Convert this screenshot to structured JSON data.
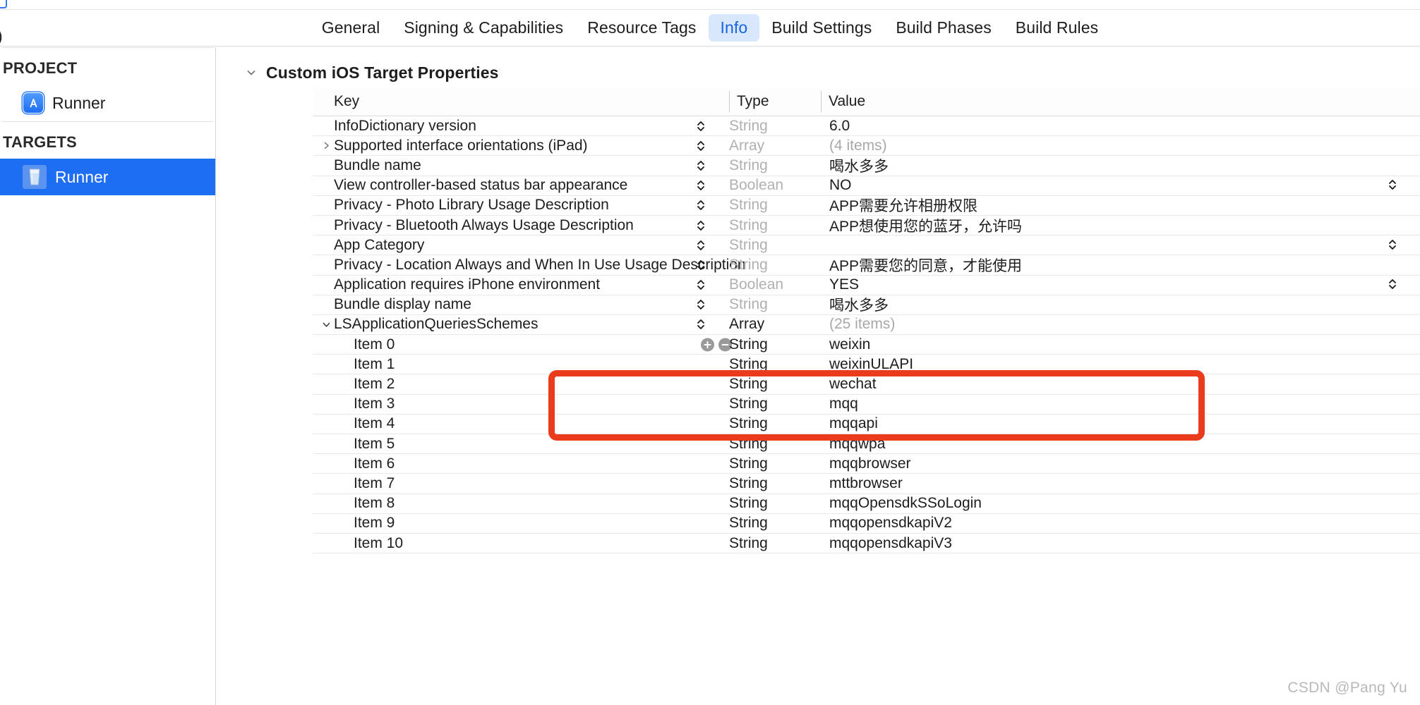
{
  "window": {
    "tabs": [
      {
        "label": "General",
        "selected": false
      },
      {
        "label": "Signing & Capabilities",
        "selected": false
      },
      {
        "label": "Resource Tags",
        "selected": false
      },
      {
        "label": "Info",
        "selected": true
      },
      {
        "label": "Build Settings",
        "selected": false
      },
      {
        "label": "Build Phases",
        "selected": false
      },
      {
        "label": "Build Rules",
        "selected": false
      }
    ],
    "accent_selected_bg": "#d9e7fd",
    "accent_selected_fg": "#1664e0",
    "annotation_color": "#ea3c1c"
  },
  "sidebar": {
    "project_header": "PROJECT",
    "project_items": [
      {
        "label": "Runner",
        "icon": "xcode-project-icon",
        "selected": false
      }
    ],
    "targets_header": "TARGETS",
    "target_items": [
      {
        "label": "Runner",
        "icon": "water-glass-app-icon",
        "selected": true
      }
    ]
  },
  "main": {
    "section_title": "Custom iOS Target Properties",
    "columns": {
      "key": "Key",
      "type": "Type",
      "value": "Value"
    },
    "rows": [
      {
        "key": "InfoDictionary version",
        "type": "String",
        "value": "6.0",
        "indent": 0,
        "arrow": "none",
        "stepper": true,
        "value_stepper": false,
        "type_dark": false,
        "value_muted": false,
        "addremove": false
      },
      {
        "key": "Supported interface orientations (iPad)",
        "type": "Array",
        "value": "(4 items)",
        "indent": 0,
        "arrow": "collapsed",
        "stepper": true,
        "value_stepper": false,
        "type_dark": false,
        "value_muted": true,
        "addremove": false
      },
      {
        "key": "Bundle name",
        "type": "String",
        "value": "喝水多多",
        "indent": 0,
        "arrow": "none",
        "stepper": true,
        "value_stepper": false,
        "type_dark": false,
        "value_muted": false,
        "addremove": false
      },
      {
        "key": "View controller-based status bar appearance",
        "type": "Boolean",
        "value": "NO",
        "indent": 0,
        "arrow": "none",
        "stepper": true,
        "value_stepper": true,
        "type_dark": false,
        "value_muted": false,
        "addremove": false
      },
      {
        "key": "Privacy - Photo Library Usage Description",
        "type": "String",
        "value": "APP需要允许相册权限",
        "indent": 0,
        "arrow": "none",
        "stepper": true,
        "value_stepper": false,
        "type_dark": false,
        "value_muted": false,
        "addremove": false
      },
      {
        "key": "Privacy - Bluetooth Always Usage Description",
        "type": "String",
        "value": "APP想使用您的蓝牙，允许吗",
        "indent": 0,
        "arrow": "none",
        "stepper": true,
        "value_stepper": false,
        "type_dark": false,
        "value_muted": false,
        "addremove": false
      },
      {
        "key": "App Category",
        "type": "String",
        "value": "",
        "indent": 0,
        "arrow": "none",
        "stepper": true,
        "value_stepper": true,
        "type_dark": false,
        "value_muted": false,
        "addremove": false
      },
      {
        "key": "Privacy - Location Always and When In Use Usage Description",
        "type": "String",
        "value": "APP需要您的同意，才能使用",
        "indent": 0,
        "arrow": "none",
        "stepper": true,
        "value_stepper": false,
        "type_dark": false,
        "value_muted": false,
        "addremove": false
      },
      {
        "key": "Application requires iPhone environment",
        "type": "Boolean",
        "value": "YES",
        "indent": 0,
        "arrow": "none",
        "stepper": true,
        "value_stepper": true,
        "type_dark": false,
        "value_muted": false,
        "addremove": false
      },
      {
        "key": "Bundle display name",
        "type": "String",
        "value": "喝水多多",
        "indent": 0,
        "arrow": "none",
        "stepper": true,
        "value_stepper": false,
        "type_dark": false,
        "value_muted": false,
        "addremove": false
      },
      {
        "key": "LSApplicationQueriesSchemes",
        "type": "Array",
        "value": "(25 items)",
        "indent": 0,
        "arrow": "expanded",
        "stepper": true,
        "value_stepper": false,
        "type_dark": true,
        "value_muted": true,
        "addremove": false
      },
      {
        "key": "Item 0",
        "type": "String",
        "value": "weixin",
        "indent": 1,
        "arrow": "none",
        "stepper": false,
        "value_stepper": false,
        "type_dark": true,
        "value_muted": false,
        "addremove": true
      },
      {
        "key": "Item 1",
        "type": "String",
        "value": "weixinULAPI",
        "indent": 1,
        "arrow": "none",
        "stepper": false,
        "value_stepper": false,
        "type_dark": true,
        "value_muted": false,
        "addremove": false
      },
      {
        "key": "Item 2",
        "type": "String",
        "value": "wechat",
        "indent": 1,
        "arrow": "none",
        "stepper": false,
        "value_stepper": false,
        "type_dark": true,
        "value_muted": false,
        "addremove": false
      },
      {
        "key": "Item 3",
        "type": "String",
        "value": "mqq",
        "indent": 1,
        "arrow": "none",
        "stepper": false,
        "value_stepper": false,
        "type_dark": true,
        "value_muted": false,
        "addremove": false
      },
      {
        "key": "Item 4",
        "type": "String",
        "value": "mqqapi",
        "indent": 1,
        "arrow": "none",
        "stepper": false,
        "value_stepper": false,
        "type_dark": true,
        "value_muted": false,
        "addremove": false
      },
      {
        "key": "Item 5",
        "type": "String",
        "value": "mqqwpa",
        "indent": 1,
        "arrow": "none",
        "stepper": false,
        "value_stepper": false,
        "type_dark": true,
        "value_muted": false,
        "addremove": false
      },
      {
        "key": "Item 6",
        "type": "String",
        "value": "mqqbrowser",
        "indent": 1,
        "arrow": "none",
        "stepper": false,
        "value_stepper": false,
        "type_dark": true,
        "value_muted": false,
        "addremove": false
      },
      {
        "key": "Item 7",
        "type": "String",
        "value": "mttbrowser",
        "indent": 1,
        "arrow": "none",
        "stepper": false,
        "value_stepper": false,
        "type_dark": true,
        "value_muted": false,
        "addremove": false
      },
      {
        "key": "Item 8",
        "type": "String",
        "value": "mqqOpensdkSSoLogin",
        "indent": 1,
        "arrow": "none",
        "stepper": false,
        "value_stepper": false,
        "type_dark": true,
        "value_muted": false,
        "addremove": false
      },
      {
        "key": "Item 9",
        "type": "String",
        "value": "mqqopensdkapiV2",
        "indent": 1,
        "arrow": "none",
        "stepper": false,
        "value_stepper": false,
        "type_dark": true,
        "value_muted": false,
        "addremove": false
      },
      {
        "key": "Item 10",
        "type": "String",
        "value": "mqqopensdkapiV3",
        "indent": 1,
        "arrow": "none",
        "stepper": false,
        "value_stepper": false,
        "type_dark": true,
        "value_muted": false,
        "addremove": false
      }
    ]
  },
  "watermark": "CSDN @Pang Yu"
}
